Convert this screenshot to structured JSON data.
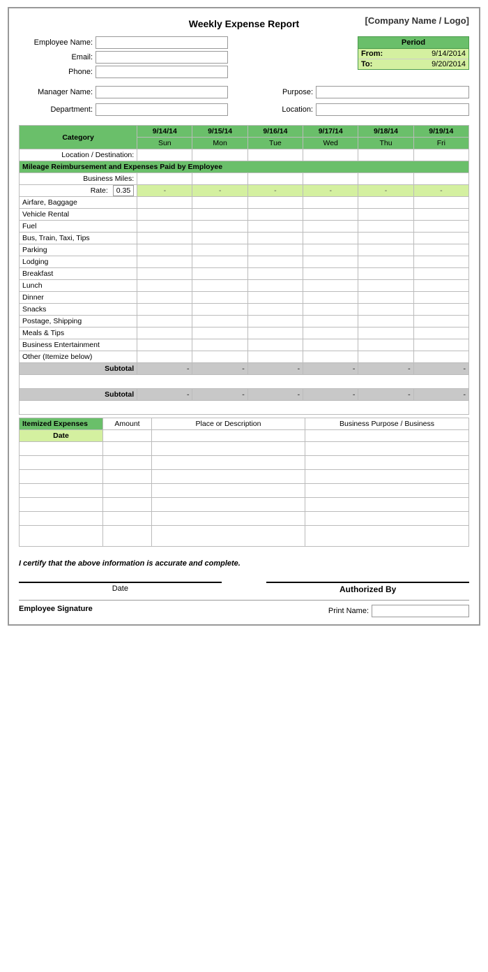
{
  "header": {
    "title": "Weekly Expense Report",
    "company": "[Company Name / Logo]"
  },
  "period": {
    "label": "Period",
    "from_label": "From:",
    "from_value": "9/14/2014",
    "to_label": "To:",
    "to_value": "9/20/2014"
  },
  "employee": {
    "name_label": "Employee Name:",
    "email_label": "Email:",
    "phone_label": "Phone:"
  },
  "manager": {
    "name_label": "Manager Name:",
    "purpose_label": "Purpose:",
    "dept_label": "Department:",
    "location_label": "Location:"
  },
  "table": {
    "category_label": "Category",
    "location_label": "Location / Destination:",
    "dates": [
      "9/14/14",
      "9/15/14",
      "9/16/14",
      "9/17/14",
      "9/18/14",
      "9/19/14"
    ],
    "days": [
      "Sun",
      "Mon",
      "Tue",
      "Wed",
      "Thu",
      "Fri"
    ],
    "mileage_section": "Mileage Reimbursement and Expenses Paid by Employee",
    "business_miles_label": "Business Miles:",
    "rate_label": "Rate:",
    "rate_value": "0.35",
    "dash": "-",
    "categories": [
      "Airfare, Baggage",
      "Vehicle Rental",
      "Fuel",
      "Bus, Train, Taxi, Tips",
      "Parking",
      "Lodging",
      "Breakfast",
      "Lunch",
      "Dinner",
      "Snacks",
      "Postage, Shipping",
      "Meals & Tips",
      "Business Entertainment",
      "Other (Itemize below)"
    ],
    "subtotal_label": "Subtotal",
    "subtotal2_label": "Subtotal"
  },
  "itemized": {
    "header": "Itemized Expenses",
    "amount_col": "Amount",
    "place_col": "Place or Description",
    "purpose_col": "Business Purpose / Business",
    "date_label": "Date",
    "rows": 7
  },
  "certification": {
    "text": "I certify that the above information is accurate and complete."
  },
  "signature": {
    "date_label": "Date",
    "authorized_label": "Authorized By"
  },
  "bottom": {
    "emp_sig_label": "Employee Signature",
    "print_name_label": "Print Name:"
  }
}
